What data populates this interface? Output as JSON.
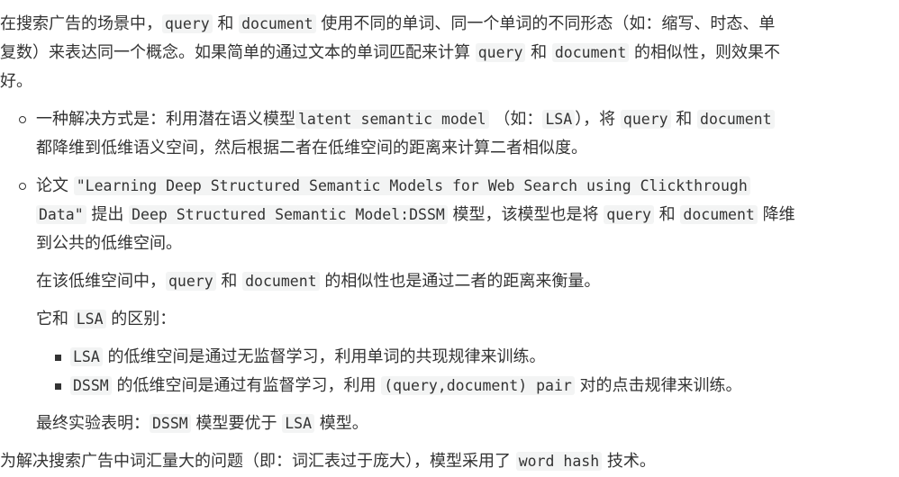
{
  "intro": {
    "line1": [
      "在搜索广告的场景中，",
      "query",
      " 和 ",
      "document",
      " 使用不同的单词、同一个单词的不同形态（如：缩写、时态、单"
    ],
    "line2": [
      "复数）来表达同一个概念。如果简单的通过文本的单词匹配来计算 ",
      "query",
      " 和 ",
      "document",
      " 的相似性，则效果不"
    ],
    "line3": "好。"
  },
  "bullet1": {
    "line1": [
      "一种解决方式是：利用潜在语义模型",
      "latent semantic model",
      " （如：",
      "LSA",
      "），将 ",
      "query",
      " 和 ",
      "document"
    ],
    "line2": "都降维到低维语义空间，然后根据二者在低维空间的距离来计算二者相似度。"
  },
  "bullet2": {
    "line1": [
      "论文 ",
      "\"Learning Deep Structured Semantic Models for Web Search using Clickthrough"
    ],
    "line2": [
      "Data\"",
      " 提出 ",
      "Deep Structured Semantic Model:DSSM",
      " 模型，该模型也是将 ",
      "query",
      " 和 ",
      "document",
      " 降维"
    ],
    "line3": "到公共的低维空间。",
    "para2": [
      "在该低维空间中，",
      "query",
      " 和 ",
      "document",
      " 的相似性也是通过二者的距离来衡量。"
    ],
    "para3": [
      "它和 ",
      "LSA",
      " 的区别："
    ],
    "sub1": [
      "LSA",
      " 的低维空间是通过无监督学习，利用单词的共现规律来训练。"
    ],
    "sub2": [
      "DSSM",
      " 的低维空间是通过有监督学习，利用 ",
      "(query,document) pair",
      " 对的点击规律来训练。"
    ],
    "para4": [
      "最终实验表明：",
      "DSSM",
      " 模型要优于 ",
      "LSA",
      " 模型。"
    ]
  },
  "outro": [
    "为解决搜索广告中词汇量大的问题（即：词汇表过于庞大），模型采用了 ",
    "word hash",
    " 技术。"
  ]
}
